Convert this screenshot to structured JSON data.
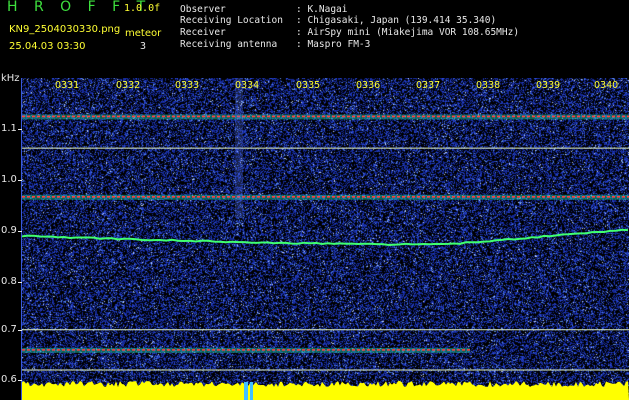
{
  "header": {
    "app_title": "H R O F F T",
    "version": "1.0.0f",
    "file_name": "KN9_2504030330.png",
    "timestamp": "25.04.03 03:30",
    "meteor_label": "meteor",
    "meteor_count": "3"
  },
  "info": {
    "observer_label": "Observer",
    "observer_value": ": K.Nagai",
    "location_label": "Receiving Location",
    "location_value": ": Chigasaki, Japan (139.414 35.340)",
    "receiver_label": "Receiver",
    "receiver_value": ": AirSpy mini (Miakejima VOR 108.65MHz)",
    "antenna_label": "Receiving antenna",
    "antenna_value": ": Maspro FM-3"
  },
  "axis": {
    "unit": "kHz",
    "y_ticks": [
      "1.1",
      "1.0",
      "0.9",
      "0.8",
      "0.7",
      "0.6"
    ],
    "x_ticks": [
      "0331",
      "0332",
      "0333",
      "0334",
      "0335",
      "0336",
      "0337",
      "0338",
      "0339",
      "0340"
    ]
  },
  "colors": {
    "background": "#000000",
    "noise": "#2a48d0",
    "carrier": "#ff4040",
    "signal_trace": "#40ff70",
    "baseline_fill": "#ffff00",
    "reference_line": "#e0f0c0"
  },
  "spectrogram": {
    "horizontal_lines_khz": [
      1.125,
      1.062,
      0.965,
      0.7,
      0.66,
      0.62
    ],
    "drifting_trace_khz_start": 0.887,
    "drifting_trace_khz_mid": 0.87,
    "drifting_trace_khz_end": 0.9
  }
}
